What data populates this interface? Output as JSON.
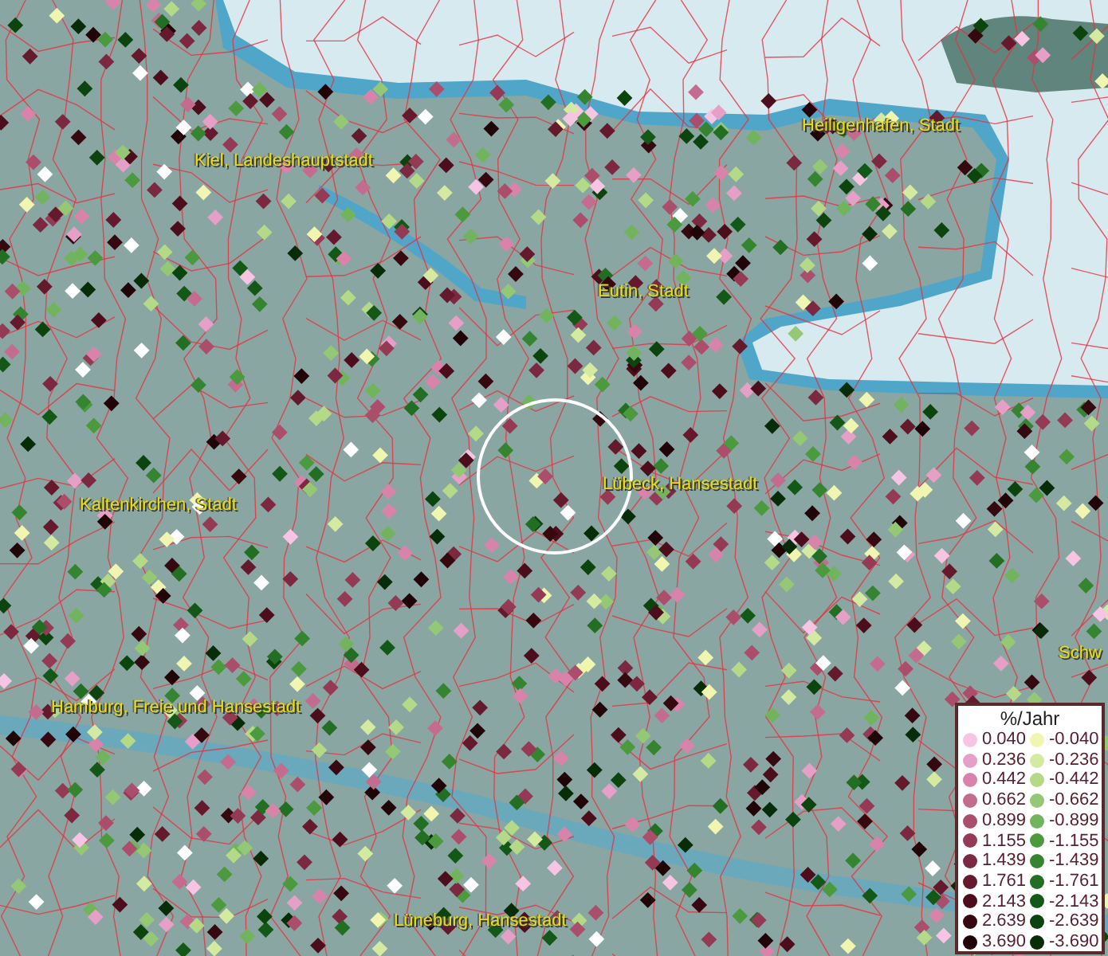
{
  "map": {
    "places": [
      {
        "name": "Kiel, Landeshauptstadt"
      },
      {
        "name": "Heiligenhafen, Stadt"
      },
      {
        "name": "Eutin, Stadt"
      },
      {
        "name": "Lübeck, Hansestadt"
      },
      {
        "name": "Kaltenkirchen, Stadt"
      },
      {
        "name": "Schw"
      },
      {
        "name": "Hamburg, Freie und Hansestadt"
      },
      {
        "name": "Lüneburg, Hansestadt"
      }
    ]
  },
  "legend": {
    "title": "%/Jahr",
    "rows": [
      {
        "positive": {
          "value": "0.040",
          "color": "#f7c4e4"
        },
        "negative": {
          "value": "-0.040",
          "color": "#f0f5b0"
        }
      },
      {
        "positive": {
          "value": "0.236",
          "color": "#e6a0c8"
        },
        "negative": {
          "value": "-0.236",
          "color": "#d4eaa0"
        }
      },
      {
        "positive": {
          "value": "0.442",
          "color": "#d884aa"
        },
        "negative": {
          "value": "-0.442",
          "color": "#b4da88"
        }
      },
      {
        "positive": {
          "value": "0.662",
          "color": "#c46c8e"
        },
        "negative": {
          "value": "-0.662",
          "color": "#94c874"
        }
      },
      {
        "positive": {
          "value": "0.899",
          "color": "#ab4e6c"
        },
        "negative": {
          "value": "-0.899",
          "color": "#72b45e"
        }
      },
      {
        "positive": {
          "value": "1.155",
          "color": "#943a55"
        },
        "negative": {
          "value": "-1.155",
          "color": "#4c9a3e"
        }
      },
      {
        "positive": {
          "value": "1.439",
          "color": "#7c2840"
        },
        "negative": {
          "value": "-1.439",
          "color": "#358530"
        }
      },
      {
        "positive": {
          "value": "1.761",
          "color": "#641a2c"
        },
        "negative": {
          "value": "-1.761",
          "color": "#226e22"
        }
      },
      {
        "positive": {
          "value": "2.143",
          "color": "#4c0e1c"
        },
        "negative": {
          "value": "-2.143",
          "color": "#135816"
        }
      },
      {
        "positive": {
          "value": "2.639",
          "color": "#360810"
        },
        "negative": {
          "value": "-2.639",
          "color": "#0c440e"
        }
      },
      {
        "positive": {
          "value": "3.690",
          "color": "#200408"
        },
        "negative": {
          "value": "-3.690",
          "color": "#062c08"
        }
      }
    ]
  }
}
